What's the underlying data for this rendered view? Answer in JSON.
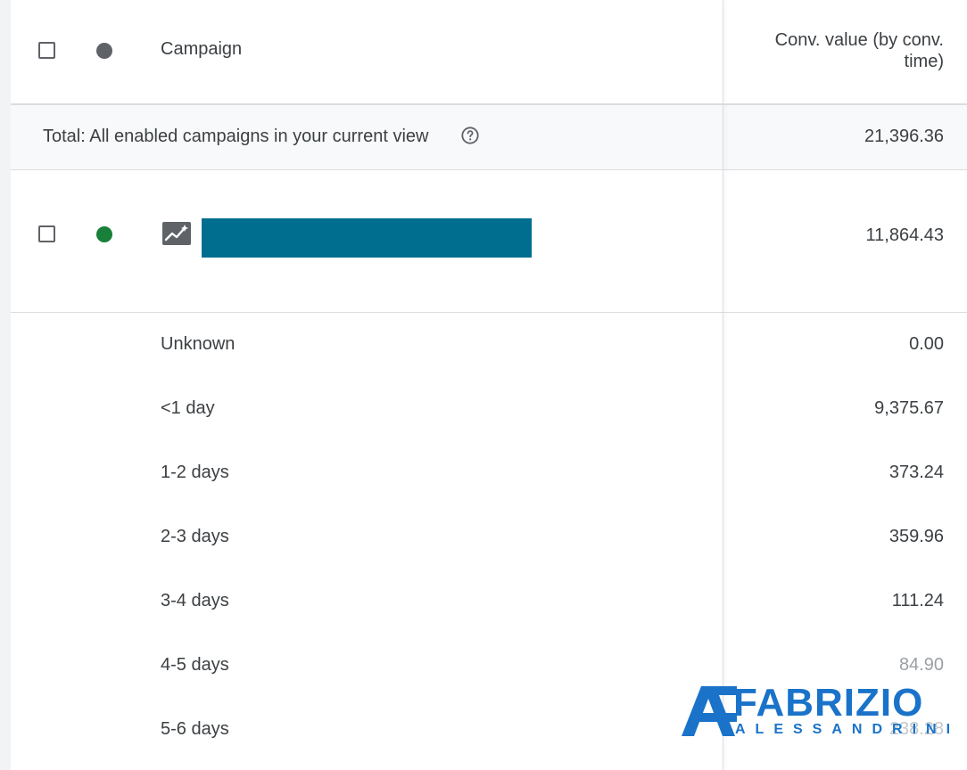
{
  "header": {
    "campaign_label": "Campaign",
    "value_label_line1": "Conv. value (by conv.",
    "value_label_line2": "time)"
  },
  "total": {
    "label": "Total: All enabled campaigns in your current view",
    "value": "21,396.36"
  },
  "campaign": {
    "status": "enabled",
    "value": "11,864.43"
  },
  "rows": [
    {
      "label": "Unknown",
      "value": "0.00"
    },
    {
      "label": "<1 day",
      "value": "9,375.67"
    },
    {
      "label": "1-2 days",
      "value": "373.24"
    },
    {
      "label": "2-3 days",
      "value": "359.96"
    },
    {
      "label": "3-4 days",
      "value": "111.24"
    },
    {
      "label": "4-5 days",
      "value": "84.90"
    },
    {
      "label": "5-6 days",
      "value": "238.28"
    }
  ],
  "watermark": {
    "line1": "FABRIZIO",
    "line2": "ALESSANDRINI"
  },
  "colors": {
    "status_enabled": "#188038",
    "status_header": "#5f6368",
    "redacted_bar": "#006e8f",
    "watermark": "#1a73c9"
  },
  "icons": [
    "checkbox-icon",
    "status-dot-icon",
    "help-icon",
    "smart-campaign-icon"
  ]
}
